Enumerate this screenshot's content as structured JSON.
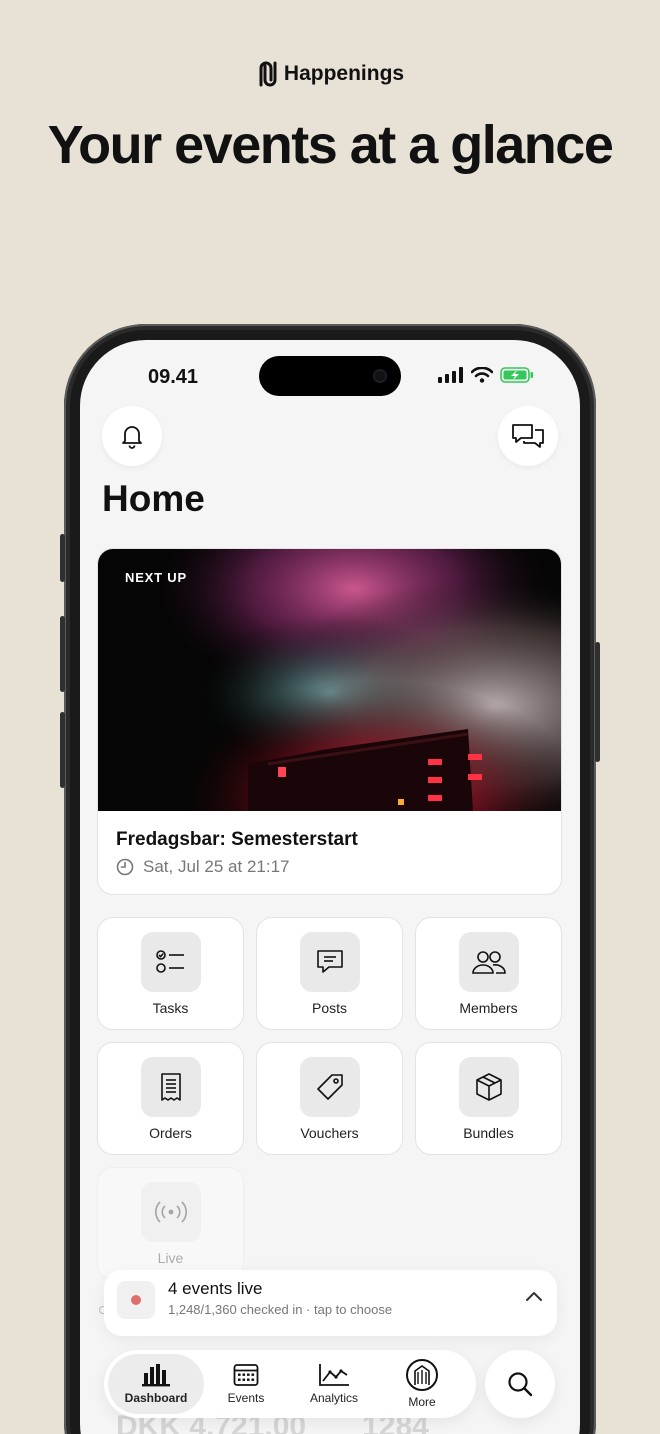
{
  "brand": {
    "name": "Happenings"
  },
  "headline": "Your events at a glance",
  "status": {
    "time": "09.41"
  },
  "page": {
    "title": "Home"
  },
  "next_event": {
    "label": "NEXT UP",
    "title": "Fredagsbar: Semesterstart",
    "date": "Sat, Jul 25 at 21:17"
  },
  "tiles": [
    {
      "label": "Tasks",
      "icon": "tasks-icon"
    },
    {
      "label": "Posts",
      "icon": "posts-icon"
    },
    {
      "label": "Members",
      "icon": "members-icon"
    },
    {
      "label": "Orders",
      "icon": "orders-icon"
    },
    {
      "label": "Vouchers",
      "icon": "vouchers-icon"
    },
    {
      "label": "Bundles",
      "icon": "bundles-icon"
    },
    {
      "label": "Live",
      "icon": "live-icon"
    }
  ],
  "live_banner": {
    "title": "4 events live",
    "subtitle": "1,248/1,360 checked in · tap to choose"
  },
  "tabs": [
    {
      "label": "Dashboard",
      "icon": "dashboard-icon",
      "active": true
    },
    {
      "label": "Events",
      "icon": "events-icon",
      "active": false
    },
    {
      "label": "Analytics",
      "icon": "analytics-icon",
      "active": false
    },
    {
      "label": "More",
      "icon": "more-icon",
      "active": false
    }
  ],
  "ghost_stats": {
    "left": "DKK 4,721.00",
    "right": "1284"
  },
  "colors": {
    "background": "#e8e1d6",
    "live_dot": "#e06d6d",
    "battery": "#34c759"
  }
}
